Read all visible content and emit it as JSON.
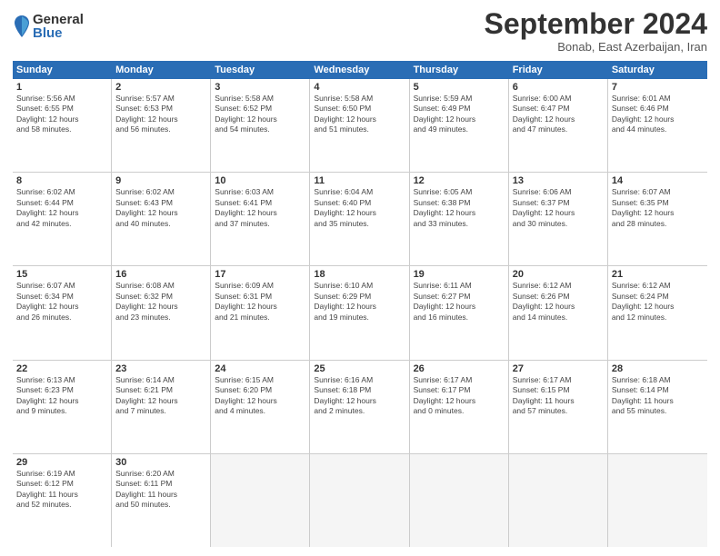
{
  "logo": {
    "general": "General",
    "blue": "Blue"
  },
  "header": {
    "month": "September 2024",
    "location": "Bonab, East Azerbaijan, Iran"
  },
  "weekdays": [
    "Sunday",
    "Monday",
    "Tuesday",
    "Wednesday",
    "Thursday",
    "Friday",
    "Saturday"
  ],
  "weeks": [
    [
      {
        "day": "1",
        "lines": [
          "Sunrise: 5:56 AM",
          "Sunset: 6:55 PM",
          "Daylight: 12 hours",
          "and 58 minutes."
        ]
      },
      {
        "day": "2",
        "lines": [
          "Sunrise: 5:57 AM",
          "Sunset: 6:53 PM",
          "Daylight: 12 hours",
          "and 56 minutes."
        ]
      },
      {
        "day": "3",
        "lines": [
          "Sunrise: 5:58 AM",
          "Sunset: 6:52 PM",
          "Daylight: 12 hours",
          "and 54 minutes."
        ]
      },
      {
        "day": "4",
        "lines": [
          "Sunrise: 5:58 AM",
          "Sunset: 6:50 PM",
          "Daylight: 12 hours",
          "and 51 minutes."
        ]
      },
      {
        "day": "5",
        "lines": [
          "Sunrise: 5:59 AM",
          "Sunset: 6:49 PM",
          "Daylight: 12 hours",
          "and 49 minutes."
        ]
      },
      {
        "day": "6",
        "lines": [
          "Sunrise: 6:00 AM",
          "Sunset: 6:47 PM",
          "Daylight: 12 hours",
          "and 47 minutes."
        ]
      },
      {
        "day": "7",
        "lines": [
          "Sunrise: 6:01 AM",
          "Sunset: 6:46 PM",
          "Daylight: 12 hours",
          "and 44 minutes."
        ]
      }
    ],
    [
      {
        "day": "8",
        "lines": [
          "Sunrise: 6:02 AM",
          "Sunset: 6:44 PM",
          "Daylight: 12 hours",
          "and 42 minutes."
        ]
      },
      {
        "day": "9",
        "lines": [
          "Sunrise: 6:02 AM",
          "Sunset: 6:43 PM",
          "Daylight: 12 hours",
          "and 40 minutes."
        ]
      },
      {
        "day": "10",
        "lines": [
          "Sunrise: 6:03 AM",
          "Sunset: 6:41 PM",
          "Daylight: 12 hours",
          "and 37 minutes."
        ]
      },
      {
        "day": "11",
        "lines": [
          "Sunrise: 6:04 AM",
          "Sunset: 6:40 PM",
          "Daylight: 12 hours",
          "and 35 minutes."
        ]
      },
      {
        "day": "12",
        "lines": [
          "Sunrise: 6:05 AM",
          "Sunset: 6:38 PM",
          "Daylight: 12 hours",
          "and 33 minutes."
        ]
      },
      {
        "day": "13",
        "lines": [
          "Sunrise: 6:06 AM",
          "Sunset: 6:37 PM",
          "Daylight: 12 hours",
          "and 30 minutes."
        ]
      },
      {
        "day": "14",
        "lines": [
          "Sunrise: 6:07 AM",
          "Sunset: 6:35 PM",
          "Daylight: 12 hours",
          "and 28 minutes."
        ]
      }
    ],
    [
      {
        "day": "15",
        "lines": [
          "Sunrise: 6:07 AM",
          "Sunset: 6:34 PM",
          "Daylight: 12 hours",
          "and 26 minutes."
        ]
      },
      {
        "day": "16",
        "lines": [
          "Sunrise: 6:08 AM",
          "Sunset: 6:32 PM",
          "Daylight: 12 hours",
          "and 23 minutes."
        ]
      },
      {
        "day": "17",
        "lines": [
          "Sunrise: 6:09 AM",
          "Sunset: 6:31 PM",
          "Daylight: 12 hours",
          "and 21 minutes."
        ]
      },
      {
        "day": "18",
        "lines": [
          "Sunrise: 6:10 AM",
          "Sunset: 6:29 PM",
          "Daylight: 12 hours",
          "and 19 minutes."
        ]
      },
      {
        "day": "19",
        "lines": [
          "Sunrise: 6:11 AM",
          "Sunset: 6:27 PM",
          "Daylight: 12 hours",
          "and 16 minutes."
        ]
      },
      {
        "day": "20",
        "lines": [
          "Sunrise: 6:12 AM",
          "Sunset: 6:26 PM",
          "Daylight: 12 hours",
          "and 14 minutes."
        ]
      },
      {
        "day": "21",
        "lines": [
          "Sunrise: 6:12 AM",
          "Sunset: 6:24 PM",
          "Daylight: 12 hours",
          "and 12 minutes."
        ]
      }
    ],
    [
      {
        "day": "22",
        "lines": [
          "Sunrise: 6:13 AM",
          "Sunset: 6:23 PM",
          "Daylight: 12 hours",
          "and 9 minutes."
        ]
      },
      {
        "day": "23",
        "lines": [
          "Sunrise: 6:14 AM",
          "Sunset: 6:21 PM",
          "Daylight: 12 hours",
          "and 7 minutes."
        ]
      },
      {
        "day": "24",
        "lines": [
          "Sunrise: 6:15 AM",
          "Sunset: 6:20 PM",
          "Daylight: 12 hours",
          "and 4 minutes."
        ]
      },
      {
        "day": "25",
        "lines": [
          "Sunrise: 6:16 AM",
          "Sunset: 6:18 PM",
          "Daylight: 12 hours",
          "and 2 minutes."
        ]
      },
      {
        "day": "26",
        "lines": [
          "Sunrise: 6:17 AM",
          "Sunset: 6:17 PM",
          "Daylight: 12 hours",
          "and 0 minutes."
        ]
      },
      {
        "day": "27",
        "lines": [
          "Sunrise: 6:17 AM",
          "Sunset: 6:15 PM",
          "Daylight: 11 hours",
          "and 57 minutes."
        ]
      },
      {
        "day": "28",
        "lines": [
          "Sunrise: 6:18 AM",
          "Sunset: 6:14 PM",
          "Daylight: 11 hours",
          "and 55 minutes."
        ]
      }
    ],
    [
      {
        "day": "29",
        "lines": [
          "Sunrise: 6:19 AM",
          "Sunset: 6:12 PM",
          "Daylight: 11 hours",
          "and 52 minutes."
        ]
      },
      {
        "day": "30",
        "lines": [
          "Sunrise: 6:20 AM",
          "Sunset: 6:11 PM",
          "Daylight: 11 hours",
          "and 50 minutes."
        ]
      },
      {
        "day": "",
        "lines": []
      },
      {
        "day": "",
        "lines": []
      },
      {
        "day": "",
        "lines": []
      },
      {
        "day": "",
        "lines": []
      },
      {
        "day": "",
        "lines": []
      }
    ]
  ]
}
